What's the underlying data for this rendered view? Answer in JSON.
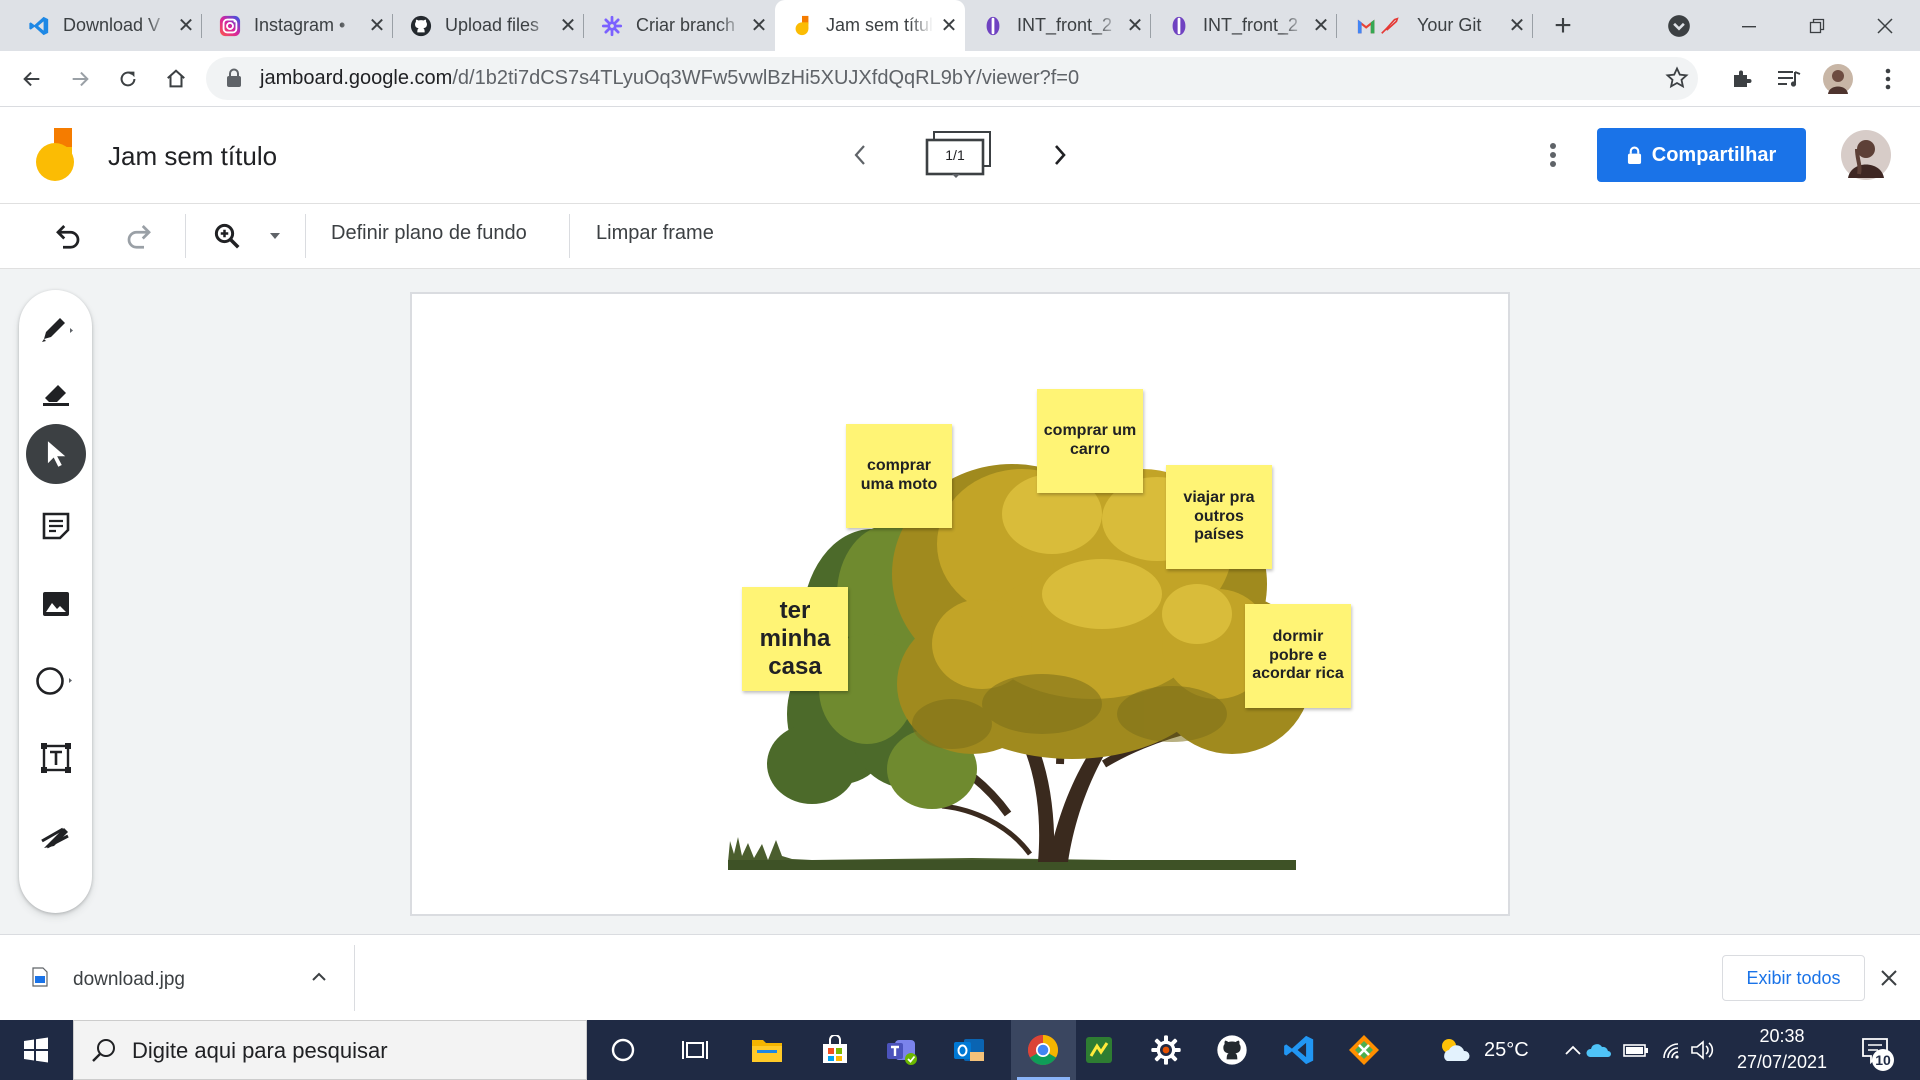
{
  "browser": {
    "tabs": [
      {
        "title": "Download V",
        "favicon": "vscode-icon"
      },
      {
        "title": "Instagram •",
        "favicon": "instagram-icon"
      },
      {
        "title": "Upload files",
        "favicon": "github-icon"
      },
      {
        "title": "Criar branch",
        "favicon": "gear-icon"
      },
      {
        "title": "Jam sem título",
        "favicon": "jamboard-icon",
        "active": true
      },
      {
        "title": "INT_front_2",
        "favicon": "app-icon"
      },
      {
        "title": "INT_front_2",
        "favicon": "app-icon"
      },
      {
        "title": "Your Git",
        "favicon": "gmail-icon"
      }
    ],
    "close_glyph": "✕",
    "new_tab_glyph": "+",
    "url_host": "jamboard.google.com",
    "url_path": "/d/1b2ti7dCS7s4TLyuOq3WFw5vwlBzHi5XUJXfdQqRL9bY/viewer?f=0"
  },
  "app": {
    "title": "Jam sem título",
    "frame_indicator": "1/1",
    "share_label": "Compartilhar",
    "accent": "#1a73e8"
  },
  "toolbar": {
    "background_label": "Definir plano de fundo",
    "clear_label": "Limpar frame"
  },
  "canvas": {
    "stickies": [
      {
        "text": "comprar uma moto",
        "color": "#fff475"
      },
      {
        "text": "comprar um carro",
        "color": "#fff475"
      },
      {
        "text": "viajar pra outros países",
        "color": "#fff475"
      },
      {
        "text": "ter minha casa",
        "color": "#fff475"
      },
      {
        "text": "dormir pobre e acordar rica",
        "color": "#fff475"
      }
    ]
  },
  "download": {
    "filename": "download.jpg",
    "show_all_label": "Exibir todos"
  },
  "taskbar": {
    "search_placeholder": "Digite aqui para pesquisar",
    "temperature": "25°C",
    "time": "20:38",
    "date": "27/07/2021",
    "notification_count": "10"
  }
}
